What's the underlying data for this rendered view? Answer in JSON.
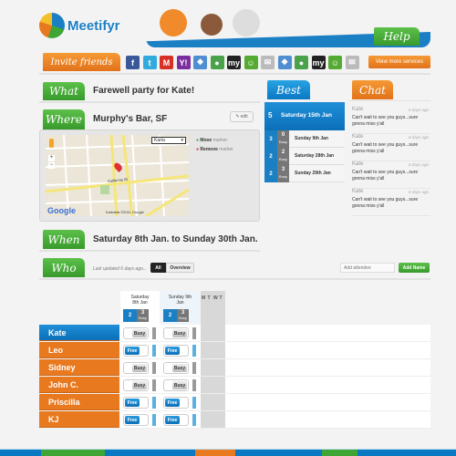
{
  "brand": {
    "name": "Meetifyr",
    "help": "Help"
  },
  "invite": {
    "label": "Invite friends",
    "more": "View more services",
    "services": [
      {
        "icon": "facebook-icon",
        "glyph": "f",
        "color": "#3b5998"
      },
      {
        "icon": "twitter-icon",
        "glyph": "t",
        "color": "#33aadd"
      },
      {
        "icon": "gmail-icon",
        "glyph": "M",
        "color": "#d93025"
      },
      {
        "icon": "yahoo-icon",
        "glyph": "Y!",
        "color": "#7b2e9f"
      },
      {
        "icon": "windows-live-icon",
        "glyph": "❖",
        "color": "#4f8ed0"
      },
      {
        "icon": "aim-icon",
        "glyph": "●",
        "color": "#4aa24a"
      },
      {
        "icon": "myspace-icon",
        "glyph": "my",
        "color": "#222222"
      },
      {
        "icon": "messenger-icon",
        "glyph": "☺",
        "color": "#55aa33"
      },
      {
        "icon": "email-icon",
        "glyph": "✉",
        "color": "#bbbbbb"
      },
      {
        "icon": "windows-live-icon",
        "glyph": "❖",
        "color": "#4f8ed0"
      },
      {
        "icon": "aim-icon",
        "glyph": "●",
        "color": "#4aa24a"
      },
      {
        "icon": "myspace-icon",
        "glyph": "my",
        "color": "#222222"
      },
      {
        "icon": "messenger-icon",
        "glyph": "☺",
        "color": "#55aa33"
      },
      {
        "icon": "email-icon",
        "glyph": "✉",
        "color": "#bbbbbb"
      }
    ]
  },
  "what": {
    "label": "What",
    "value": "Farewell party for Kate!"
  },
  "where": {
    "label": "Where",
    "value": "Murphy's Bar, SF",
    "edit": "edit",
    "map_type": "Karta",
    "move": "Move",
    "remove": "Remove",
    "marker": "marker",
    "street": "California St",
    "copyright": "Kartdata ©2011 Google",
    "google": "Google"
  },
  "when": {
    "label": "When",
    "value": "Saturday 8th Jan. to Sunday 30th Jan."
  },
  "who": {
    "label": "Who",
    "updated": "Last updated 6 days ago...",
    "all": "All",
    "overview": "Overview",
    "add_placeholder": "Add attendee",
    "add_button": "Add Name",
    "days": [
      {
        "label": "Saturday 8th Jan",
        "count": "2",
        "busy": "3"
      },
      {
        "label": "Sunday 9th Jan",
        "count": "2",
        "busy": "3"
      }
    ],
    "busy_label": "Busy",
    "weekdays": [
      "M",
      "T",
      "W",
      "T"
    ],
    "people": [
      {
        "name": "Kate",
        "status": [
          "Busy",
          "Busy"
        ]
      },
      {
        "name": "Leo",
        "status": [
          "Free",
          "Free"
        ]
      },
      {
        "name": "Sidney",
        "status": [
          "Busy",
          "Busy"
        ]
      },
      {
        "name": "John C.",
        "status": [
          "Busy",
          "Busy"
        ]
      },
      {
        "name": "Priscilla",
        "status": [
          "Free",
          "Free"
        ]
      },
      {
        "name": "KJ",
        "status": [
          "Free",
          "Free"
        ]
      }
    ]
  },
  "best": {
    "label": "Best",
    "top": {
      "count": "5",
      "date": "Saturday 15th Jan"
    },
    "rows": [
      {
        "count": "3",
        "busy": "0",
        "date": "Sunday 9th Jan"
      },
      {
        "count": "2",
        "busy": "2",
        "date": "Saturday 28th Jan"
      },
      {
        "count": "2",
        "busy": "3",
        "date": "Sunday 29th Jan"
      }
    ],
    "busy_label": "Busy"
  },
  "chat": {
    "label": "Chat",
    "messages": [
      {
        "name": "Kate",
        "time": "6 days ago",
        "text": "Can't wait to see you guys...sure gonna miss y'all"
      },
      {
        "name": "Kate",
        "time": "6 days ago",
        "text": "Can't wait to see you guys...sure gonna miss y'all"
      },
      {
        "name": "Kate",
        "time": "6 days ago",
        "text": "Can't wait to see you guys...sure gonna miss y'all"
      },
      {
        "name": "Kate",
        "time": "6 days ago",
        "text": "Can't wait to see you guys...sure gonna miss y'all"
      }
    ]
  },
  "colors": {
    "green": "#3fa535",
    "blue": "#0b78c4",
    "orange": "#e8791f"
  }
}
